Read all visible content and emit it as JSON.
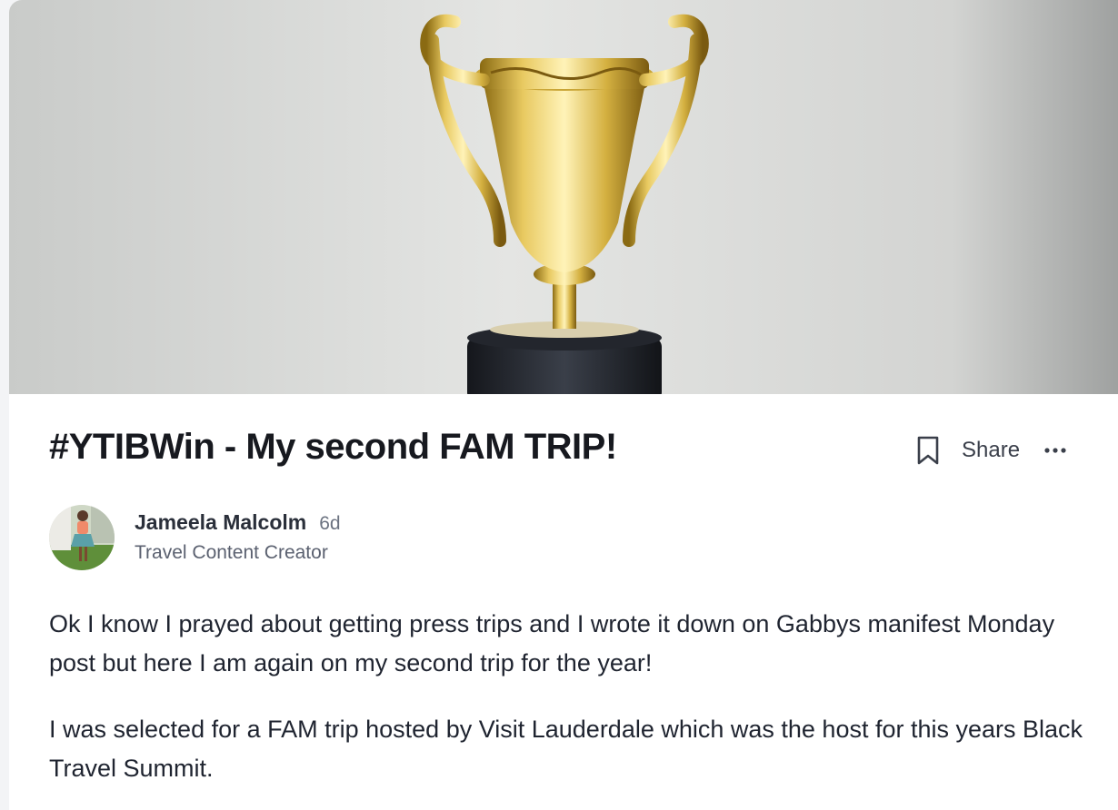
{
  "post": {
    "cover_image": "trophy-photo",
    "title": "#YTIBWin - My second FAM TRIP!",
    "actions": {
      "bookmark_icon": "bookmark-icon",
      "share_label": "Share",
      "more_icon": "more-horizontal-icon"
    },
    "author": {
      "name": "Jameela Malcolm",
      "time_ago": "6d",
      "role": "Travel Content Creator"
    },
    "paragraphs": [
      "Ok I know I prayed about getting press trips and I wrote it down on Gabbys manifest Monday post but here I am again on my second trip for the year!",
      "I was selected for a FAM trip hosted by Visit Lauderdale which was the host for this years Black Travel Summit."
    ]
  }
}
